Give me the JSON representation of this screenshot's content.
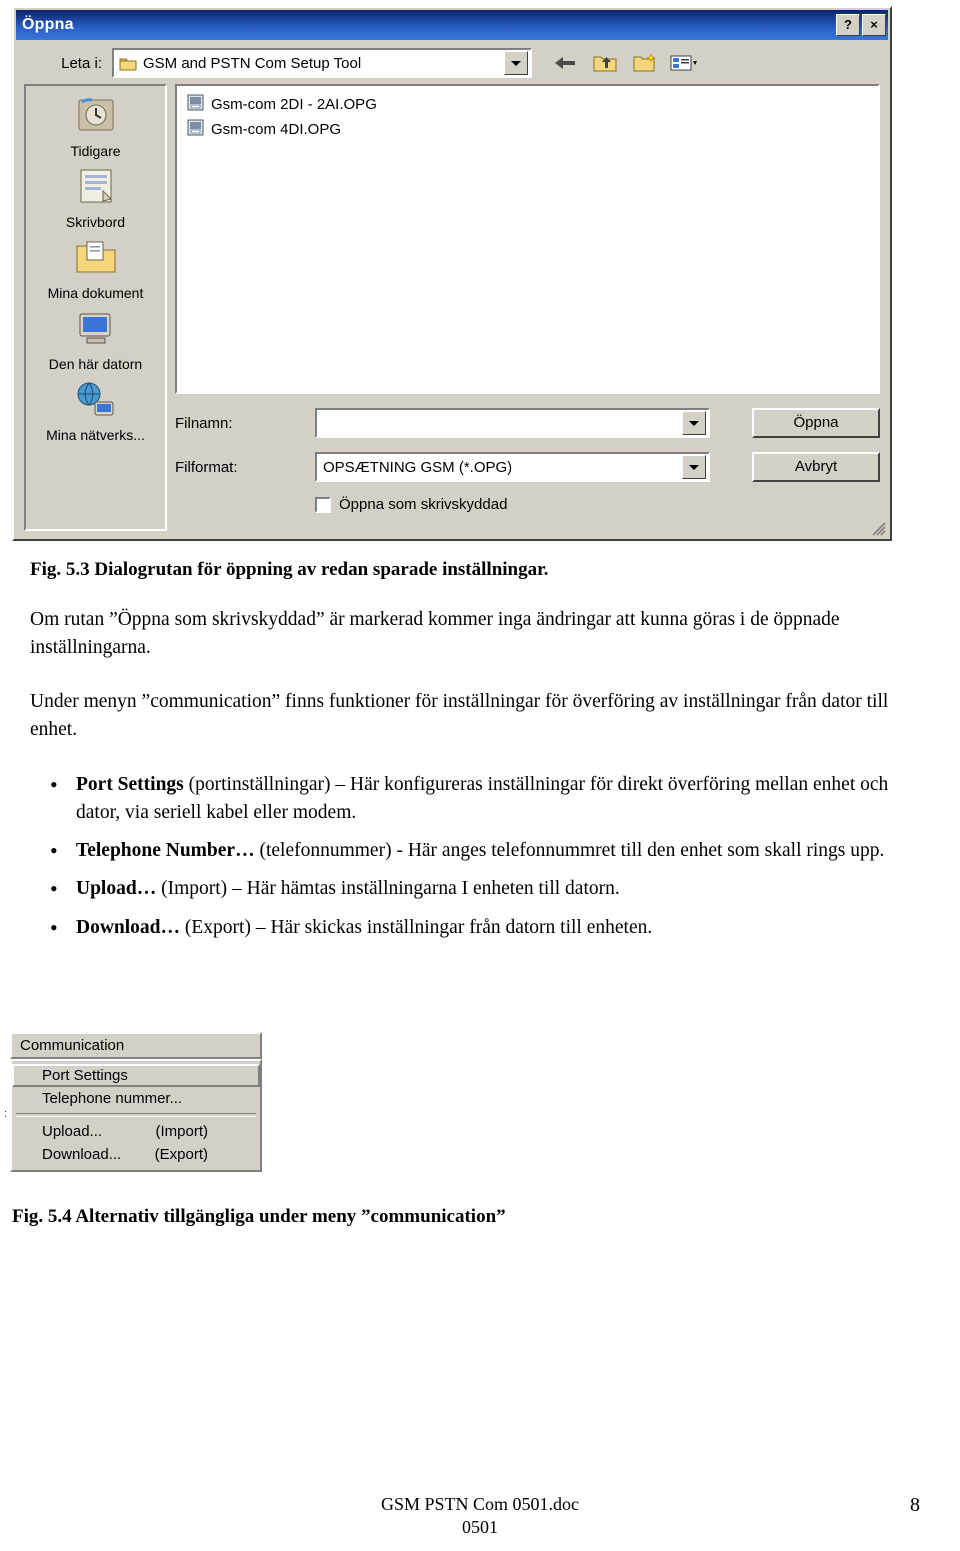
{
  "dialog": {
    "title": "Öppna",
    "help_btn": "?",
    "close_btn": "×",
    "lookin_label": "Leta i:",
    "lookin_value": "GSM and PSTN Com Setup Tool",
    "toolbar_icons": [
      "back-arrow-icon",
      "up-one-level-icon",
      "new-folder-icon",
      "views-icon"
    ],
    "places": [
      {
        "label": "Tidigare",
        "icon": "history-icon"
      },
      {
        "label": "Skrivbord",
        "icon": "desktop-icon"
      },
      {
        "label": "Mina dokument",
        "icon": "my-documents-icon"
      },
      {
        "label": "Den här datorn",
        "icon": "my-computer-icon"
      },
      {
        "label": "Mina nätverks...",
        "icon": "network-places-icon"
      }
    ],
    "files": [
      {
        "name": "Gsm-com 2DI - 2AI.OPG",
        "icon": "opg-file-icon"
      },
      {
        "name": "Gsm-com 4DI.OPG",
        "icon": "opg-file-icon"
      }
    ],
    "filename_label": "Filnamn:",
    "filename_value": "",
    "filetype_label": "Filformat:",
    "filetype_value": "OPSÆTNING GSM (*.OPG)",
    "open_button": "Öppna",
    "cancel_button": "Avbryt",
    "readonly_label": "Öppna som skrivskyddad",
    "readonly_checked": false
  },
  "document": {
    "fig53_caption": "Fig. 5.3 Dialogrutan för öppning av redan sparade inställningar.",
    "para1": "Om rutan ”Öppna som skrivskyddad” är markerad kommer inga ändringar att kunna göras i de öppnade inställningarna.",
    "para2": "Under menyn ”communication” finns funktioner för inställningar för överföring av inställningar från dator till enhet.",
    "bullets": [
      {
        "term": "Port Settings",
        "rest": " (portinställningar) – Här konfigureras inställningar för direkt överföring mellan enhet och dator, via seriell kabel eller modem."
      },
      {
        "term": "Telephone Number…",
        "rest": " (telefonnummer) - Här anges telefonnummret till den enhet som skall rings upp."
      },
      {
        "term": "Upload…",
        "rest": " (Import) – Här hämtas inställningarna I enheten till datorn."
      },
      {
        "term": "Download…",
        "rest": " (Export) – Här skickas inställningar från datorn till enheten."
      }
    ],
    "fig54_caption": "Fig. 5.4 Alternativ tillgängliga under meny ”communication”"
  },
  "menu_shot": {
    "header": "Communication",
    "items": [
      {
        "label": "Port Settings",
        "sub": "",
        "selected": true
      },
      {
        "label": "Telephone nummer...",
        "sub": "",
        "selected": false
      },
      {
        "label": "Upload...",
        "sub": "(Import)",
        "selected": false
      },
      {
        "label": "Download...",
        "sub": "(Export)",
        "selected": false
      }
    ]
  },
  "footer": {
    "doc_name": "GSM PSTN Com  0501.doc",
    "doc_rev": "0501",
    "page_number": "8"
  }
}
